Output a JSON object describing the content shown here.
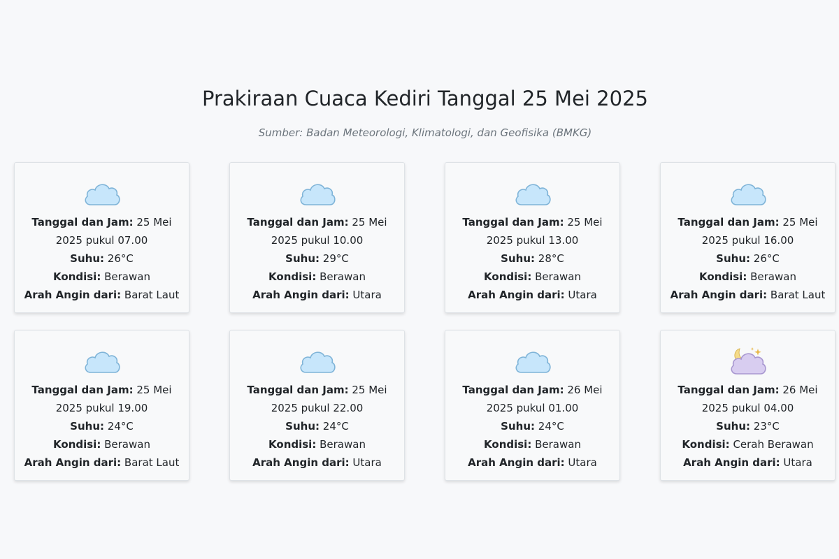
{
  "page": {
    "title": "Prakiraan Cuaca Kediri Tanggal 25 Mei 2025",
    "source": "Sumber: Badan Meteorologi, Klimatologi, dan Geofisika (BMKG)"
  },
  "labels": {
    "datetime": "Tanggal dan Jam:",
    "temp": "Suhu:",
    "condition": "Kondisi:",
    "wind": "Arah Angin dari:"
  },
  "forecasts": [
    {
      "datetime": "25 Mei 2025 pukul 07.00",
      "temp": "26°C",
      "condition": "Berawan",
      "wind": "Barat Laut",
      "icon": "cloud-icon"
    },
    {
      "datetime": "25 Mei 2025 pukul 10.00",
      "temp": "29°C",
      "condition": "Berawan",
      "wind": "Utara",
      "icon": "cloud-icon"
    },
    {
      "datetime": "25 Mei 2025 pukul 13.00",
      "temp": "28°C",
      "condition": "Berawan",
      "wind": "Utara",
      "icon": "cloud-icon"
    },
    {
      "datetime": "25 Mei 2025 pukul 16.00",
      "temp": "26°C",
      "condition": "Berawan",
      "wind": "Barat Laut",
      "icon": "cloud-icon"
    },
    {
      "datetime": "25 Mei 2025 pukul 19.00",
      "temp": "24°C",
      "condition": "Berawan",
      "wind": "Barat Laut",
      "icon": "cloud-icon"
    },
    {
      "datetime": "25 Mei 2025 pukul 22.00",
      "temp": "24°C",
      "condition": "Berawan",
      "wind": "Utara",
      "icon": "cloud-icon"
    },
    {
      "datetime": "26 Mei 2025 pukul 01.00",
      "temp": "24°C",
      "condition": "Berawan",
      "wind": "Utara",
      "icon": "cloud-icon"
    },
    {
      "datetime": "26 Mei 2025 pukul 04.00",
      "temp": "23°C",
      "condition": "Cerah Berawan",
      "wind": "Utara",
      "icon": "moon-cloud-icon"
    }
  ],
  "colors": {
    "cloud_fill": "#c7e6fb",
    "cloud_stroke": "#7fb4d8",
    "night_cloud_fill": "#d8cdf0",
    "night_cloud_stroke": "#a897d0",
    "moon": "#f6dc8a",
    "star": "#e8b84a"
  }
}
